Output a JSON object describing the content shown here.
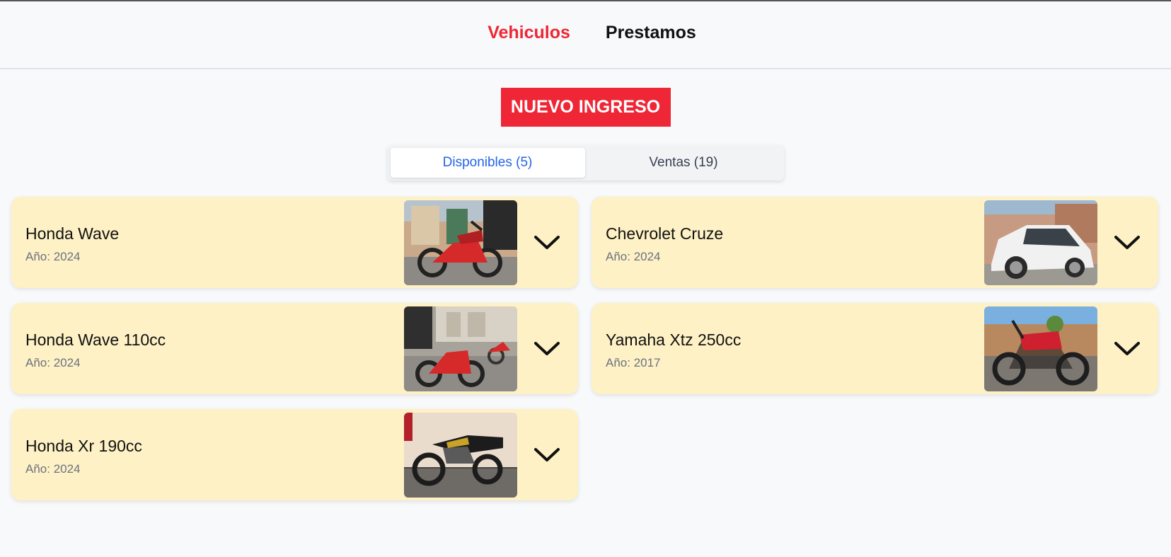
{
  "nav": {
    "items": [
      {
        "label": "Vehiculos",
        "active": true
      },
      {
        "label": "Prestamos",
        "active": false
      }
    ]
  },
  "actions": {
    "new_entry_label": "NUEVO INGRESO"
  },
  "tabs": [
    {
      "label": "Disponibles (5)",
      "active": true
    },
    {
      "label": "Ventas (19)",
      "active": false
    }
  ],
  "vehicles": [
    {
      "name": "Honda Wave",
      "year": "Año: 2024",
      "image": "red-scooter-photo"
    },
    {
      "name": "Chevrolet Cruze",
      "year": "Año: 2024",
      "image": "white-hatchback-photo"
    },
    {
      "name": "Honda Wave 110cc",
      "year": "Año: 2024",
      "image": "red-scooter-garage-photo"
    },
    {
      "name": "Yamaha Xtz 250cc",
      "year": "Año: 2017",
      "image": "red-dirtbike-photo"
    },
    {
      "name": "Honda Xr 190cc",
      "year": "Año: 2024",
      "image": "black-dirtbike-photo"
    }
  ],
  "colors": {
    "accent": "#ef2636",
    "tab_active": "#2563eb",
    "card_bg": "#fef1c5",
    "page_bg": "#f8f9fb"
  },
  "icons": {
    "expand": "chevron-down-icon"
  }
}
